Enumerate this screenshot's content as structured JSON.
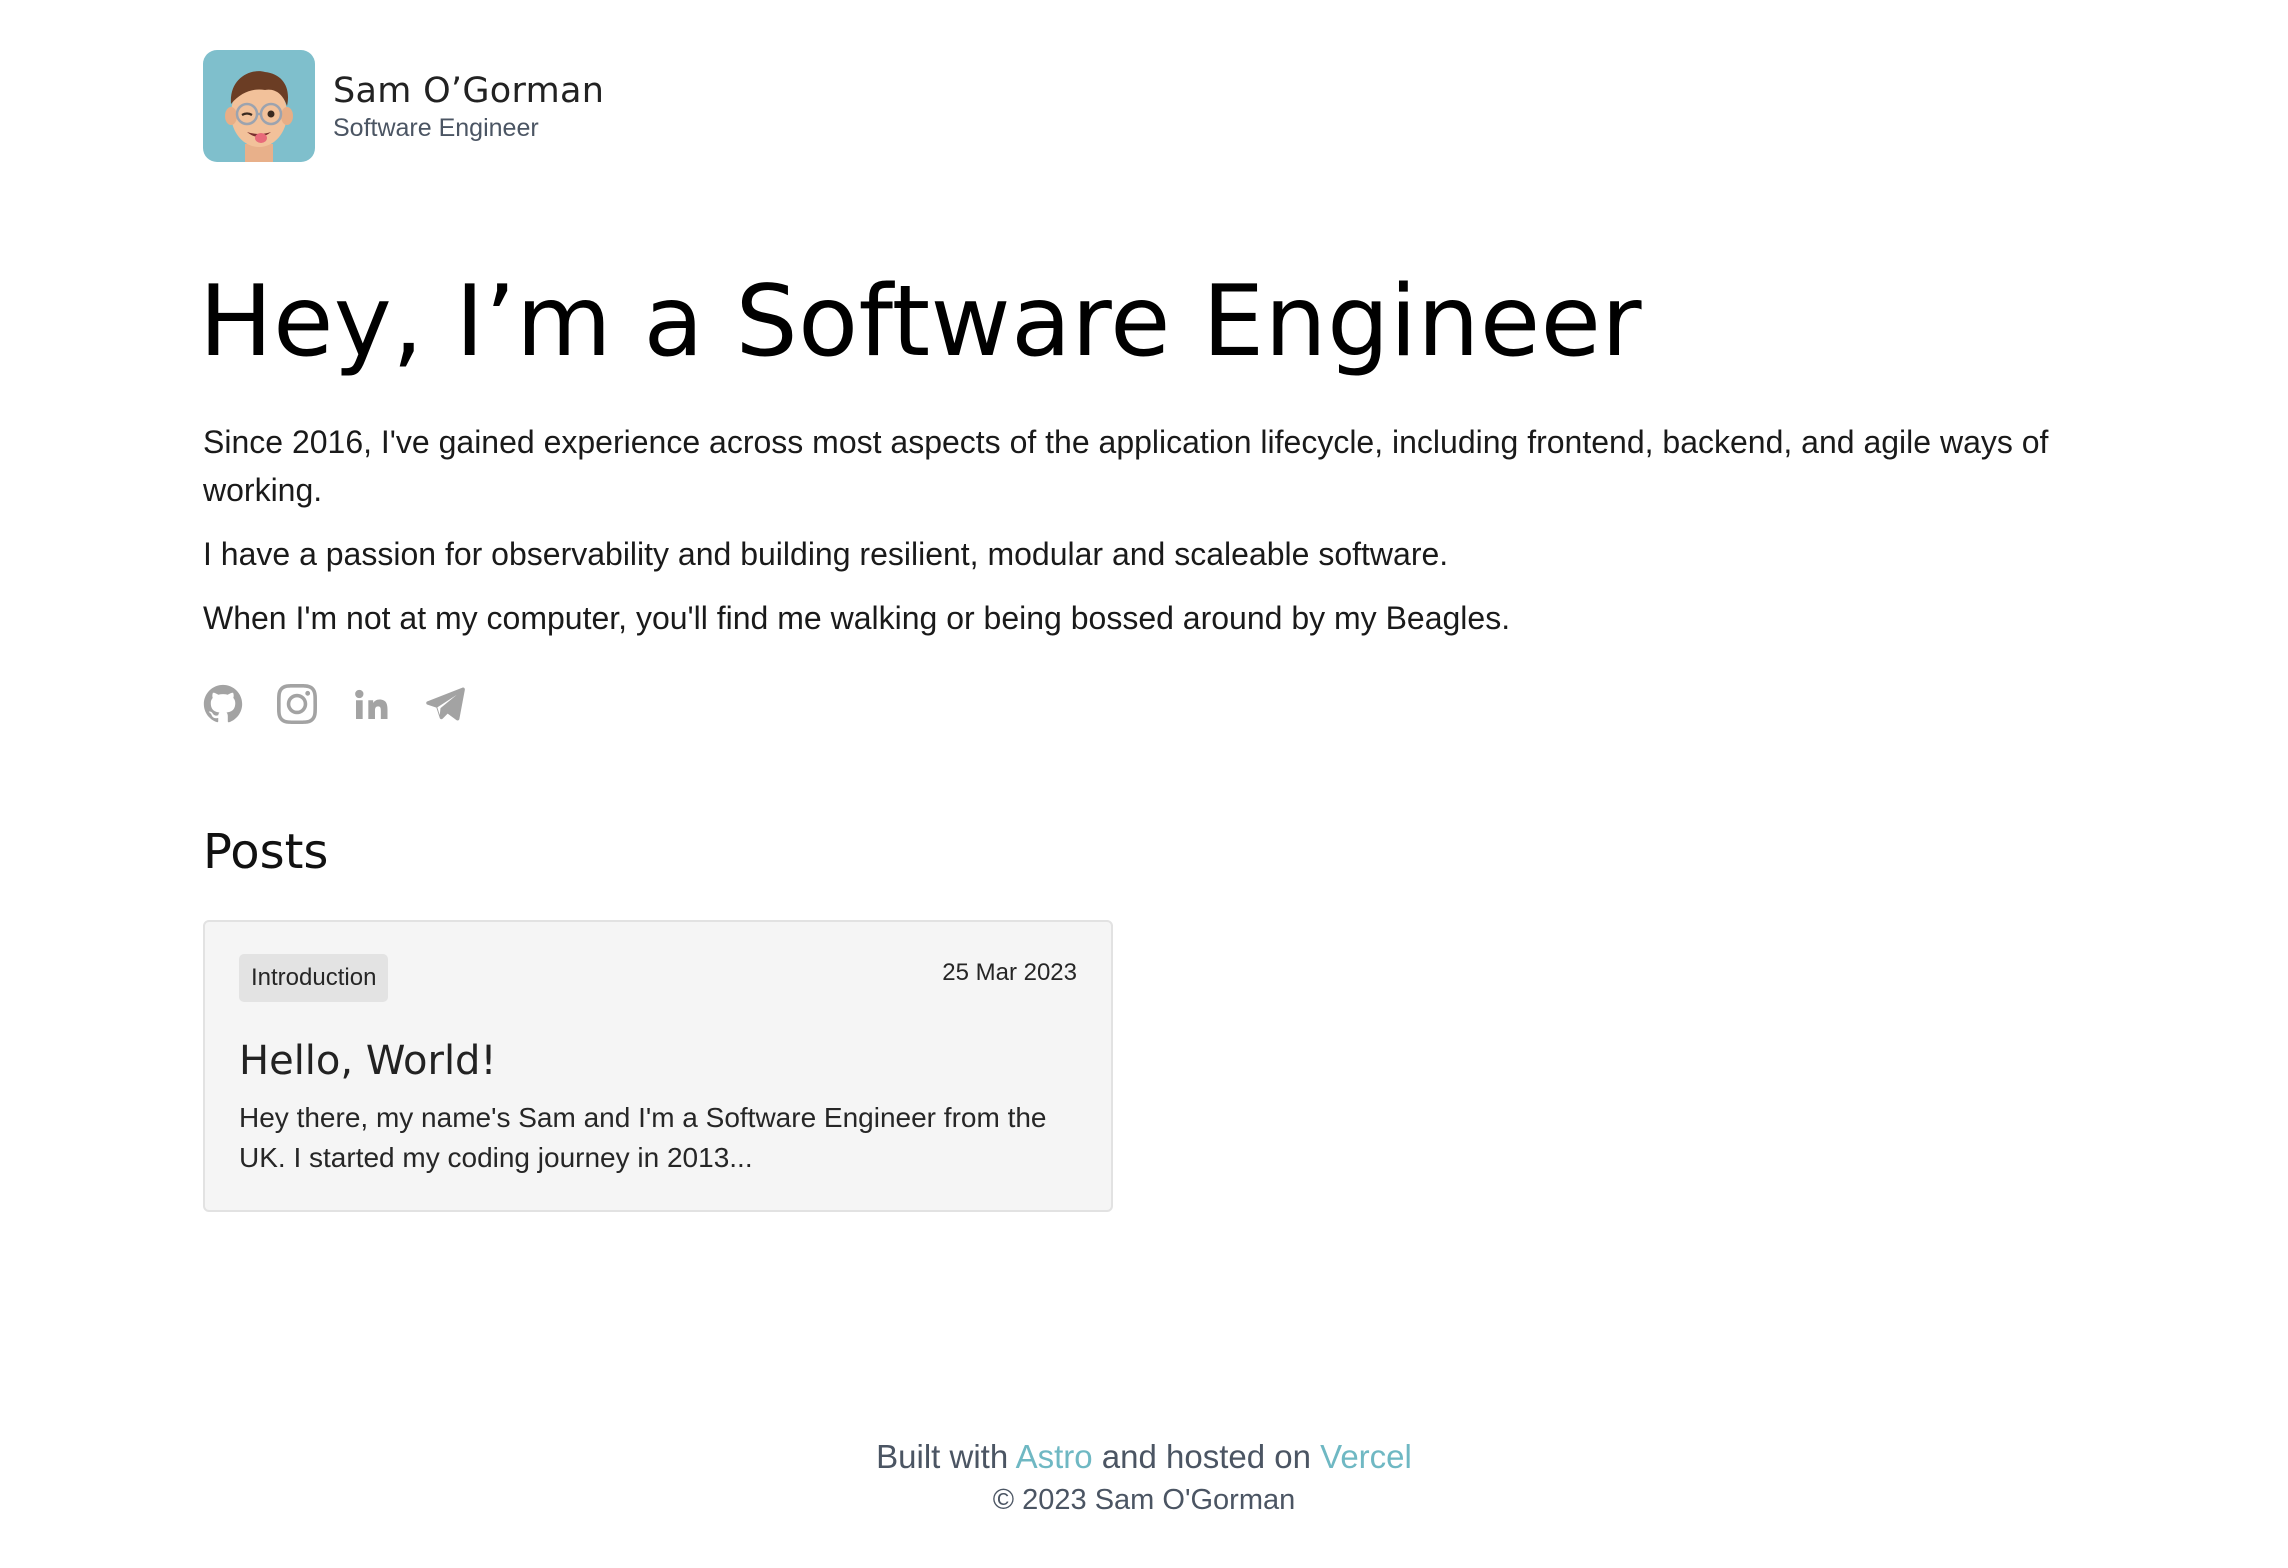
{
  "header": {
    "name": "Sam O’Gorman",
    "title": "Software Engineer",
    "avatar_bg": "#7fbfcc"
  },
  "hero": {
    "heading": "Hey, I’m a Software Engineer",
    "paragraphs": [
      "Since 2016, I've gained experience across most aspects of the application lifecycle, including frontend, backend, and agile ways of working.",
      "I have a passion for observability and building resilient, modular and scaleable software.",
      "When I'm not at my computer, you'll find me walking or being bossed around by my Beagles."
    ]
  },
  "socials": [
    {
      "icon": "github-icon"
    },
    {
      "icon": "instagram-icon"
    },
    {
      "icon": "linkedin-icon"
    },
    {
      "icon": "telegram-icon"
    }
  ],
  "posts": {
    "heading": "Posts",
    "items": [
      {
        "tag": "Introduction",
        "date": "25 Mar 2023",
        "title": "Hello, World!",
        "excerpt": "Hey there, my name's Sam and I'm a Software Engineer from the UK. I started my coding journey in 2013..."
      }
    ]
  },
  "footer": {
    "built_with": "Built with",
    "astro": "Astro",
    "hosted_on": "and hosted on",
    "vercel": "Vercel",
    "copyright": "© 2023 Sam O'Gorman"
  },
  "colors": {
    "accent": "#6fb8c3",
    "icon_grey": "#a3a3a3",
    "card_bg": "#f5f5f5"
  }
}
